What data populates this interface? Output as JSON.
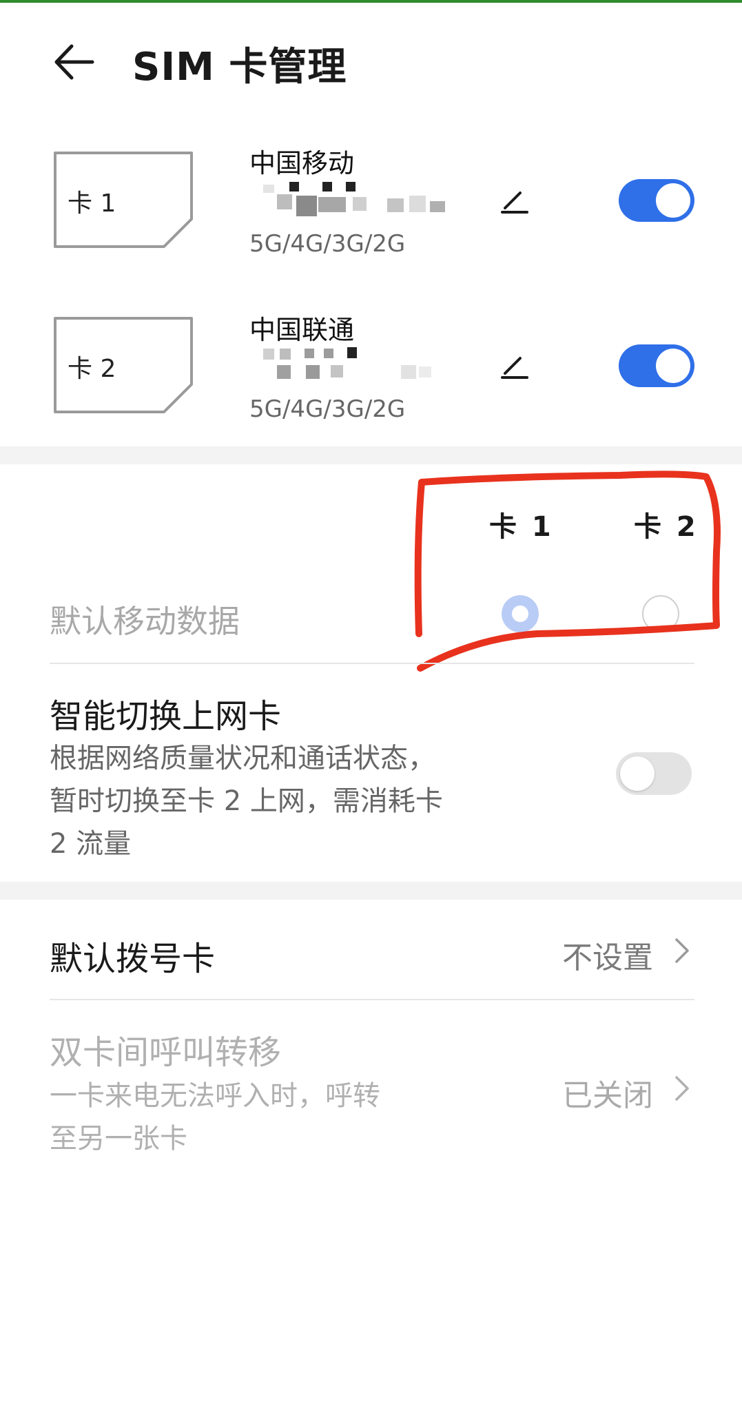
{
  "header": {
    "title": "SIM 卡管理"
  },
  "sims": [
    {
      "card_label": "卡 1",
      "carrier": "中国移动",
      "network": "5G/4G/3G/2G",
      "enabled": true
    },
    {
      "card_label": "卡 2",
      "carrier": "中国联通",
      "network": "5G/4G/3G/2G",
      "enabled": true
    }
  ],
  "default_data": {
    "label": "默认移动数据",
    "col1": "卡 1",
    "col2": "卡 2",
    "selected": "卡 1"
  },
  "smart_switch": {
    "title": "智能切换上网卡",
    "desc_line1": "根据网络质量状况和通话状态，",
    "desc_line2": "暂时切换至卡 2 上网，需消耗卡",
    "desc_line3": "2 流量",
    "enabled": false
  },
  "default_dial": {
    "label": "默认拨号卡",
    "value": "不设置"
  },
  "call_forward": {
    "title": "双卡间呼叫转移",
    "desc_line1": "一卡来电无法呼入时，呼转",
    "desc_line2": "至另一张卡",
    "value": "已关闭"
  },
  "colors": {
    "accent": "#2f6fe8",
    "annotation": "#e8321e"
  }
}
